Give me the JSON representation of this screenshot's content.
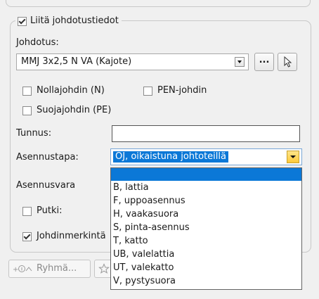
{
  "group": {
    "checkbox_label": "Liitä johdotustiedot",
    "checked": true
  },
  "johdotus": {
    "label": "Johdotus:",
    "value": "MMJ 3x2,5 N VA (Kajote)",
    "more_label": "..."
  },
  "checkboxes": {
    "nollajohdin": "Nollajohdin (N)",
    "pen": "PEN-johdin",
    "suojajohdin": "Suojajohdin (PE)",
    "putki": "Putki:",
    "johdinmerkinta": "Johdinmerkintä"
  },
  "tunnus": {
    "label": "Tunnus:",
    "value": ""
  },
  "asennustapa": {
    "label": "Asennustapa:",
    "selected": "OJ, oikaistuna johtoteillä",
    "options": [
      "",
      "B, lattia",
      "F, uppoasennus",
      "H, vaakasuora",
      "S, pinta-asennus",
      "T, katto",
      "UB, valelattia",
      "UT, valekatto",
      "V, pystysuora"
    ]
  },
  "asennusvara": {
    "label": "Asennusvara"
  },
  "bottom": {
    "ryhma_label": "Ryhmä..."
  },
  "icons": [
    "checkbox-icon",
    "dropdown-arrow-icon",
    "cursor-pointer-icon",
    "group-add-icon",
    "star-icon"
  ]
}
